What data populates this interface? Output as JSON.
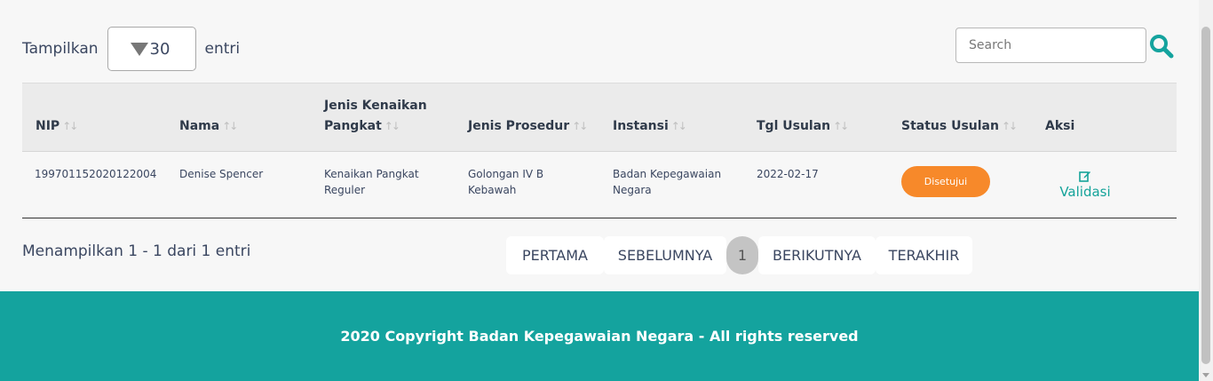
{
  "length": {
    "prefix": "Tampilkan",
    "value": "30",
    "suffix": "entri"
  },
  "search": {
    "placeholder": "Search"
  },
  "table": {
    "headers": {
      "nip": "NIP",
      "nama": "Nama",
      "jenis_kenaikan_line1": "Jenis Kenaikan",
      "jenis_kenaikan_line2": "Pangkat",
      "jenis_prosedur": "Jenis Prosedur",
      "instansi": "Instansi",
      "tgl_usulan": "Tgl Usulan",
      "status_usulan": "Status Usulan",
      "aksi": "Aksi"
    },
    "sort_glyph": "↑↓",
    "rows": [
      {
        "nip": "199701152020122004",
        "nama": "Denise Spencer",
        "jenis_kenaikan_line1": "Kenaikan Pangkat",
        "jenis_kenaikan_line2": "Reguler",
        "jenis_prosedur_line1": "Golongan IV B",
        "jenis_prosedur_line2": "Kebawah",
        "instansi_line1": "Badan Kepegawaian",
        "instansi_line2": "Negara",
        "tgl_usulan": "2022-02-17",
        "status": "Disetujui",
        "action": "Validasi"
      }
    ]
  },
  "info": "Menampilkan 1 - 1 dari 1 entri",
  "pagination": {
    "first": "PERTAMA",
    "prev": "SEBELUMNYA",
    "current": "1",
    "next": "BERIKUTNYA",
    "last": "TERAKHIR"
  },
  "footer": {
    "text": "2020 Copyright Badan Kepegawaian Negara - All rights reserved"
  },
  "colors": {
    "accent": "#14a39e",
    "status": "#f7892a"
  }
}
